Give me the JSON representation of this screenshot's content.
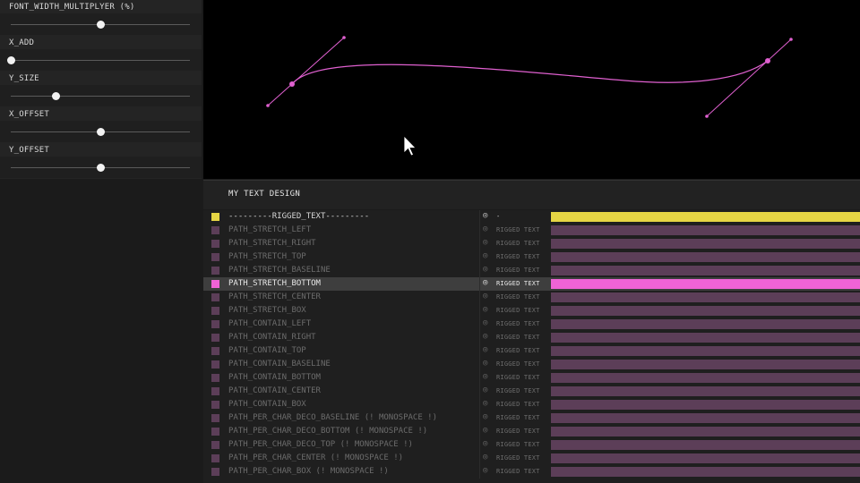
{
  "params": [
    {
      "label": "FONT_WIDTH_MULTIPLYER (%)",
      "value": 0.5
    },
    {
      "label": "X_ADD",
      "value": 0.0
    },
    {
      "label": "Y_SIZE",
      "value": 0.25
    },
    {
      "label": "X_OFFSET",
      "value": 0.5
    },
    {
      "label": "Y_OFFSET",
      "value": 0.5
    }
  ],
  "design": {
    "title": "MY TEXT DESIGN"
  },
  "colors": {
    "accent_yellow": "#e6d544",
    "accent_pink": "#f063d6",
    "inactive_layer": "#5c3e58",
    "curve": "#e060d0"
  },
  "layers": [
    {
      "name": "---------RIGGED_TEXT---------",
      "icon": "spiral-icon",
      "type": "-",
      "color": "#e6d544",
      "state": "active"
    },
    {
      "name": "PATH_STRETCH_LEFT",
      "icon": "spiral-icon",
      "type": "RIGGED TEXT",
      "color": "#5c3e58",
      "state": "inactive"
    },
    {
      "name": "PATH_STRETCH_RIGHT",
      "icon": "spiral-icon",
      "type": "RIGGED TEXT",
      "color": "#5c3e58",
      "state": "inactive"
    },
    {
      "name": "PATH_STRETCH_TOP",
      "icon": "spiral-icon",
      "type": "RIGGED TEXT",
      "color": "#5c3e58",
      "state": "inactive"
    },
    {
      "name": "PATH_STRETCH_BASELINE",
      "icon": "spiral-icon",
      "type": "RIGGED TEXT",
      "color": "#5c3e58",
      "state": "inactive"
    },
    {
      "name": "PATH_STRETCH_BOTTOM",
      "icon": "spiral-icon",
      "type": "RIGGED TEXT",
      "color": "#f063d6",
      "state": "selected"
    },
    {
      "name": "PATH_STRETCH_CENTER",
      "icon": "spiral-icon",
      "type": "RIGGED TEXT",
      "color": "#5c3e58",
      "state": "inactive"
    },
    {
      "name": "PATH_STRETCH_BOX",
      "icon": "spiral-icon",
      "type": "RIGGED TEXT",
      "color": "#5c3e58",
      "state": "inactive"
    },
    {
      "name": "PATH_CONTAIN_LEFT",
      "icon": "spiral-icon",
      "type": "RIGGED TEXT",
      "color": "#5c3e58",
      "state": "inactive"
    },
    {
      "name": "PATH_CONTAIN_RIGHT",
      "icon": "spiral-icon",
      "type": "RIGGED TEXT",
      "color": "#5c3e58",
      "state": "inactive"
    },
    {
      "name": "PATH_CONTAIN_TOP",
      "icon": "spiral-icon",
      "type": "RIGGED TEXT",
      "color": "#5c3e58",
      "state": "inactive"
    },
    {
      "name": "PATH_CONTAIN_BASELINE",
      "icon": "spiral-icon",
      "type": "RIGGED TEXT",
      "color": "#5c3e58",
      "state": "inactive"
    },
    {
      "name": "PATH_CONTAIN_BOTTOM",
      "icon": "spiral-icon",
      "type": "RIGGED TEXT",
      "color": "#5c3e58",
      "state": "inactive"
    },
    {
      "name": "PATH_CONTAIN_CENTER",
      "icon": "spiral-icon",
      "type": "RIGGED TEXT",
      "color": "#5c3e58",
      "state": "inactive"
    },
    {
      "name": "PATH_CONTAIN_BOX",
      "icon": "spiral-icon",
      "type": "RIGGED TEXT",
      "color": "#5c3e58",
      "state": "inactive"
    },
    {
      "name": "PATH_PER_CHAR_DECO_BASELINE (! MONOSPACE !)",
      "icon": "spiral-icon",
      "type": "RIGGED TEXT",
      "color": "#5c3e58",
      "state": "inactive"
    },
    {
      "name": "PATH_PER_CHAR_DECO_BOTTOM (! MONOSPACE !)",
      "icon": "spiral-icon",
      "type": "RIGGED TEXT",
      "color": "#5c3e58",
      "state": "inactive"
    },
    {
      "name": "PATH_PER_CHAR_DECO_TOP (! MONOSPACE !)",
      "icon": "spiral-icon",
      "type": "RIGGED TEXT",
      "color": "#5c3e58",
      "state": "inactive"
    },
    {
      "name": "PATH_PER_CHAR_CENTER (! MONOSPACE !)",
      "icon": "spiral-icon",
      "type": "RIGGED TEXT",
      "color": "#5c3e58",
      "state": "inactive"
    },
    {
      "name": "PATH_PER_CHAR_BOX (! MONOSPACE !)",
      "icon": "spiral-icon",
      "type": "RIGGED TEXT",
      "color": "#5c3e58",
      "state": "inactive"
    }
  ]
}
